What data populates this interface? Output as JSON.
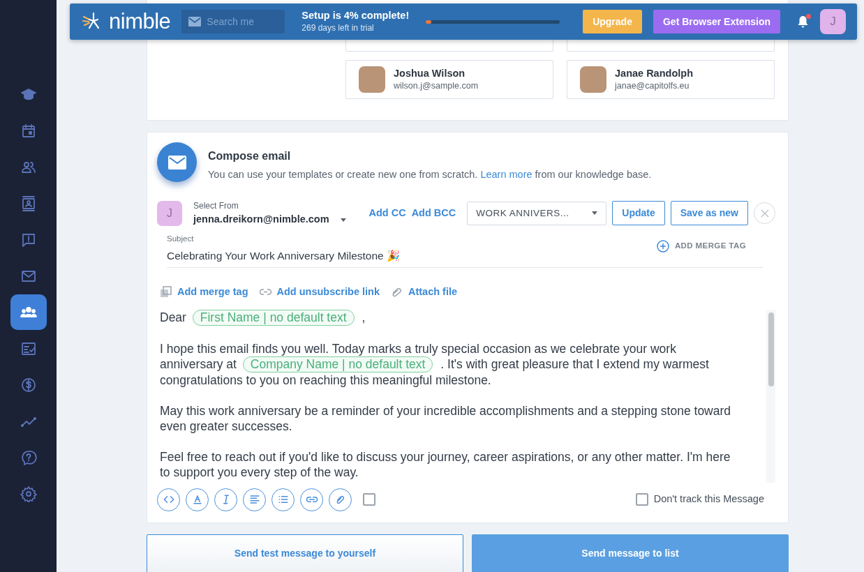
{
  "sidebar": {
    "items": [
      {
        "selected": false
      },
      {
        "selected": false
      },
      {
        "selected": false
      },
      {
        "selected": false
      },
      {
        "selected": false
      },
      {
        "selected": false
      },
      {
        "selected": true
      },
      {
        "selected": false
      },
      {
        "selected": false
      },
      {
        "selected": false
      },
      {
        "selected": false
      },
      {
        "selected": false
      }
    ]
  },
  "header": {
    "logo": "nimble",
    "search": {
      "placeholder": "Search me"
    },
    "setup": {
      "title": "Setup is 4% complete!",
      "subtitle": "269 days left in trial",
      "level": 0.04
    },
    "buttons": [
      {
        "label": "Upgrade",
        "kind": "upgrade"
      },
      {
        "label": "Get Browser Extension",
        "kind": "extension"
      }
    ],
    "notifications": {
      "unread": true
    },
    "avatar": "J"
  },
  "contacts": [
    {
      "name": "Joshua Wilson",
      "email": "wilson.j@sample.com"
    },
    {
      "name": "Janae Randolph",
      "email": "janae@capitolfs.eu"
    }
  ],
  "compose": {
    "title": "Compose email",
    "description": {
      "before": "You can use your templates or create new one from scratch. ",
      "link": "Learn more",
      "after": " from our knowledge base."
    },
    "from": {
      "avatar": "J",
      "label": "Select From",
      "email": "jenna.dreikorn@nimble.com"
    },
    "links": [
      "Add CC",
      "Add BCC"
    ],
    "template": "WORK ANNIVERS...",
    "buttons": [
      "Update",
      "Save as new"
    ],
    "subject": {
      "label": "Subject",
      "value": "Celebrating Your Work Anniversary Milestone 🎉",
      "merge_tag": "ADD MERGE TAG"
    },
    "actions": [
      "Add merge tag",
      "Add unsubscribe link",
      "Attach file"
    ],
    "body": [
      [
        {
          "kind": "text",
          "text": "Dear "
        },
        {
          "kind": "tag",
          "text": "First Name | no default text"
        },
        {
          "kind": "text",
          "text": " ,"
        }
      ],
      [
        {
          "kind": "text",
          "text": "I hope this email finds you well. Today marks a truly special occasion as we celebrate your work anniversary at "
        },
        {
          "kind": "tag",
          "text": "Company Name | no default text"
        },
        {
          "kind": "text",
          "text": " . It's with great pleasure that I extend my warmest congratulations to you on reaching this meaningful milestone."
        }
      ],
      [
        {
          "kind": "text",
          "text": "May this work anniversary be a reminder of your incredible accomplishments and a stepping stone toward even greater successes."
        }
      ],
      [
        {
          "kind": "text",
          "text": "Feel free to reach out if you'd like to discuss your journey, career aspirations, or any other matter. I'm here to support you every step of the way."
        }
      ]
    ],
    "dont_track": {
      "label": "Don't track this Message",
      "checked": false
    }
  },
  "footer": {
    "buttons": [
      {
        "label": "Send test message to yourself",
        "kind": "secondary"
      },
      {
        "label": "Send message to list",
        "kind": "primary"
      }
    ]
  }
}
